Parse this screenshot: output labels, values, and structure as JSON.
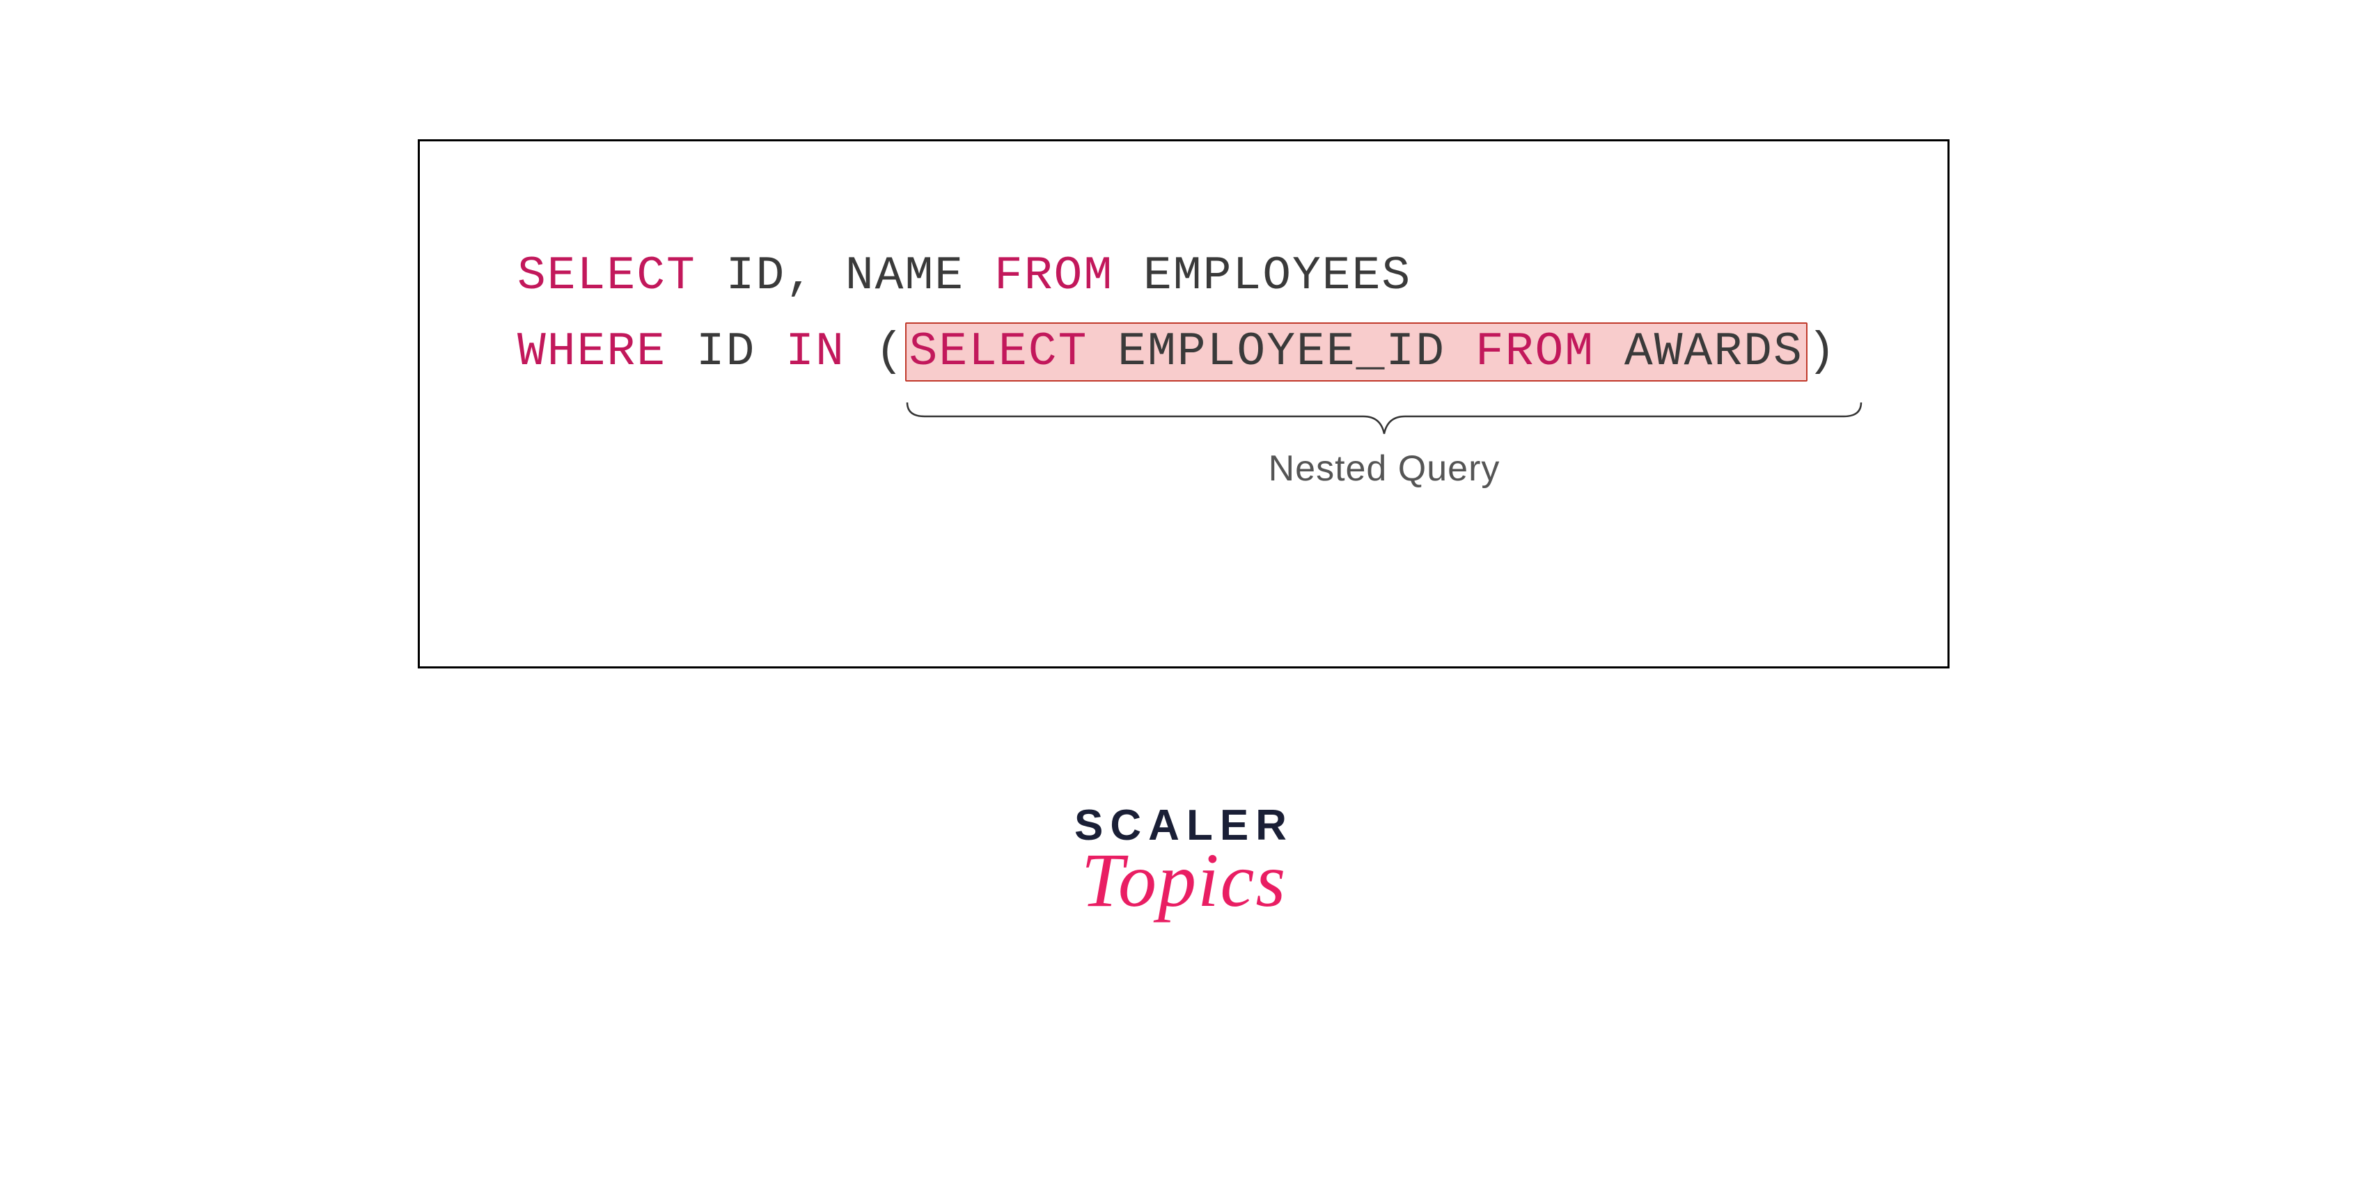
{
  "sql": {
    "line1": {
      "kw_select": "SELECT",
      "cols": " ID, NAME ",
      "kw_from": "FROM",
      "table": " EMPLOYEES"
    },
    "line2": {
      "kw_where": "WHERE",
      "col": " ID ",
      "kw_in": "IN",
      "paren_open": " (",
      "nested": {
        "kw_select": "SELECT",
        "col": " EMPLOYEE_ID ",
        "kw_from": "FROM",
        "table": " AWARDS"
      },
      "paren_close": ")"
    }
  },
  "annotation": {
    "label": "Nested Query"
  },
  "logo": {
    "line1": "SCALER",
    "line2": "Topics"
  }
}
